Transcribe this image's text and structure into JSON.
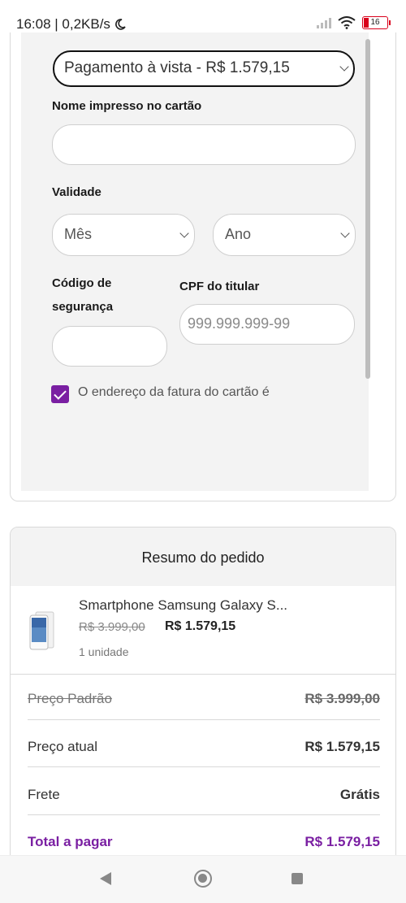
{
  "status": {
    "time_speed": "16:08 | 0,2KB/s",
    "battery": "16"
  },
  "payment": {
    "option_selected": "Pagamento à vista - R$ 1.579,15",
    "name_label": "Nome impresso no cartão",
    "name_value": "",
    "validity_label": "Validade",
    "month_placeholder": "Mês",
    "year_placeholder": "Ano",
    "security_label_line1": "Código de",
    "security_label_line2": "segurança",
    "security_value": "",
    "cpf_label": "CPF do titular",
    "cpf_placeholder": "999.999.999-99",
    "billing_checkbox_text": "O endereço da fatura do cartão é",
    "billing_checked": true
  },
  "summary": {
    "title": "Resumo do pedido",
    "product_name": "Smartphone Samsung Galaxy S...",
    "old_price": "R$ 3.999,00",
    "new_price": "R$ 1.579,15",
    "quantity": "1 unidade",
    "rows": [
      {
        "label": "Preço Padrão",
        "value": "R$ 3.999,00"
      },
      {
        "label": "Preço atual",
        "value": "R$ 1.579,15"
      },
      {
        "label": "Frete",
        "value": "Grátis"
      },
      {
        "label": "Total a pagar",
        "value": "R$ 1.579,15"
      }
    ]
  },
  "colors": {
    "accent": "#7a1fa2",
    "border": "#d9d9d9",
    "panel": "#f3f3f3"
  }
}
